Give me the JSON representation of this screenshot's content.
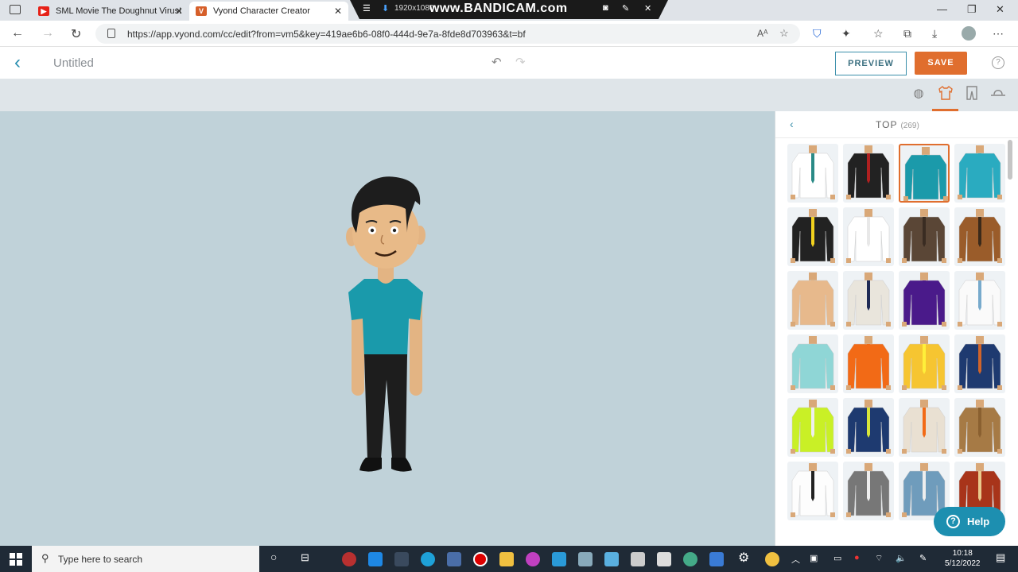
{
  "browser": {
    "tabs": [
      {
        "label": "SML Movie The Doughnut Virus!",
        "favicon": "youtube-icon",
        "color": "#e62117"
      },
      {
        "label": "Vyond Character Creator",
        "favicon": "vyond-icon",
        "color": "#d65f2a"
      }
    ],
    "recorder": {
      "resolution": "1920x1080",
      "brand": "www.BANDICAM.com"
    },
    "url": "https://app.vyond.com/cc/edit?from=vm5&key=419ae6b6-08f0-444d-9e7a-8fde8d703963&t=bf"
  },
  "app": {
    "title": "Untitled",
    "preview_label": "PREVIEW",
    "save_label": "SAVE",
    "accent": "#e06e2e",
    "categories": [
      "head-icon",
      "top-icon",
      "bottom-icon",
      "hat-icon"
    ],
    "active_category": "top-icon"
  },
  "panel": {
    "title": "TOP",
    "count": "(269)",
    "items": [
      {
        "name": "white-shirt-teal-tie",
        "body": "#ffffff",
        "accent": "#2a8a86"
      },
      {
        "name": "black-tuxedo",
        "body": "#222222",
        "accent": "#b02020"
      },
      {
        "name": "teal-tshirt",
        "body": "#1b9aaa",
        "accent": "#1b9aaa"
      },
      {
        "name": "teal-polo",
        "body": "#2aabc0",
        "accent": "#2aabc0"
      },
      {
        "name": "black-suit-yellow-tie",
        "body": "#222222",
        "accent": "#f2d21e"
      },
      {
        "name": "white-dress-shirt",
        "body": "#ffffff",
        "accent": "#e8e8e8"
      },
      {
        "name": "striped-sweater",
        "body": "#5a4636",
        "accent": "#3a2c22"
      },
      {
        "name": "brown-suit",
        "body": "#9a5c2a",
        "accent": "#3b2a1a"
      },
      {
        "name": "bare-chest",
        "body": "#e7b98c",
        "accent": "#e7b98c"
      },
      {
        "name": "security-shirt-navy-tie",
        "body": "#e9e5dc",
        "accent": "#1e2a55"
      },
      {
        "name": "purple-polo",
        "body": "#4a1a8a",
        "accent": "#4a1a8a"
      },
      {
        "name": "white-lab-coat",
        "body": "#fafafa",
        "accent": "#7ac"
      },
      {
        "name": "scrubs",
        "body": "#8fd6d6",
        "accent": "#8fd6d6"
      },
      {
        "name": "orange-jacket",
        "body": "#f26a16",
        "accent": "#f26a16"
      },
      {
        "name": "yellow-safety-jacket",
        "body": "#f6c531",
        "accent": "#ffef3a"
      },
      {
        "name": "navy-harness-jacket",
        "body": "#1e3a70",
        "accent": "#d0642a"
      },
      {
        "name": "hi-vis-jacket",
        "body": "#c9f026",
        "accent": "#eeeeee"
      },
      {
        "name": "navy-hi-vis-vest",
        "body": "#1e3a70",
        "accent": "#d8e63a"
      },
      {
        "name": "orange-safety-vest",
        "body": "#e9e0d2",
        "accent": "#f26a16"
      },
      {
        "name": "brown-trench-coat",
        "body": "#a67a45",
        "accent": "#8a6030"
      },
      {
        "name": "suspenders-bowtie",
        "body": "#fdfdfd",
        "accent": "#222222"
      },
      {
        "name": "grey-vest-bowtie",
        "body": "#777777",
        "accent": "#eeeeee"
      },
      {
        "name": "overalls",
        "body": "#6f9cbc",
        "accent": "#eeeeee"
      },
      {
        "name": "varsity-jacket",
        "body": "#a8341a",
        "accent": "#e9c98c"
      }
    ],
    "help_label": "Help"
  },
  "taskbar": {
    "search_placeholder": "Type here to search",
    "time": "10:18",
    "date": "5/12/2022"
  }
}
